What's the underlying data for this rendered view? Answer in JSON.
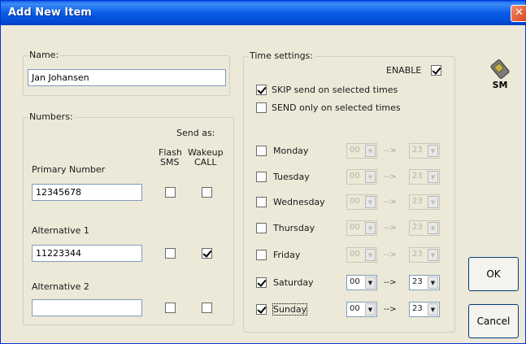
{
  "window": {
    "title": "Add New Item",
    "close_glyph": "✕"
  },
  "name_group": {
    "label": "Name:",
    "value": "Jan Johansen"
  },
  "numbers_group": {
    "label": "Numbers:",
    "send_as_label": "Send as:",
    "flash_sms_header_line1": "Flash",
    "flash_sms_header_line2": "SMS",
    "wakeup_call_header_line1": "Wakeup",
    "wakeup_call_header_line2": "CALL",
    "rows": [
      {
        "label": "Primary Number",
        "value": "12345678",
        "flash_sms": false,
        "wakeup_call": false
      },
      {
        "label": "Alternative 1",
        "value": "11223344",
        "flash_sms": false,
        "wakeup_call": true
      },
      {
        "label": "Alternative 2",
        "value": "",
        "flash_sms": false,
        "wakeup_call": false
      }
    ]
  },
  "time_settings": {
    "label": "Time settings:",
    "enable_label": "ENABLE",
    "enable_checked": true,
    "skip_label": "SKIP send on selected times",
    "skip_checked": true,
    "send_only_label": "SEND only on selected times",
    "send_only_checked": false,
    "arrow": "-->",
    "days": [
      {
        "label": "Monday",
        "checked": false,
        "from": "00",
        "to": "23",
        "enabled": false
      },
      {
        "label": "Tuesday",
        "checked": false,
        "from": "00",
        "to": "23",
        "enabled": false
      },
      {
        "label": "Wednesday",
        "checked": false,
        "from": "00",
        "to": "23",
        "enabled": false
      },
      {
        "label": "Thursday",
        "checked": false,
        "from": "00",
        "to": "23",
        "enabled": false
      },
      {
        "label": "Friday",
        "checked": false,
        "from": "00",
        "to": "23",
        "enabled": false
      },
      {
        "label": "Saturday",
        "checked": true,
        "from": "00",
        "to": "23",
        "enabled": true
      },
      {
        "label": "Sunday",
        "checked": true,
        "from": "00",
        "to": "23",
        "enabled": true
      }
    ]
  },
  "buttons": {
    "ok_label": "OK",
    "cancel_label": "Cancel"
  },
  "logo": {
    "text": "SM",
    "icon": "sim-card-icon"
  },
  "colors": {
    "titlebar": "#0a5de6",
    "dialog_bg": "#ece9d8",
    "close_button": "#d9441e"
  }
}
